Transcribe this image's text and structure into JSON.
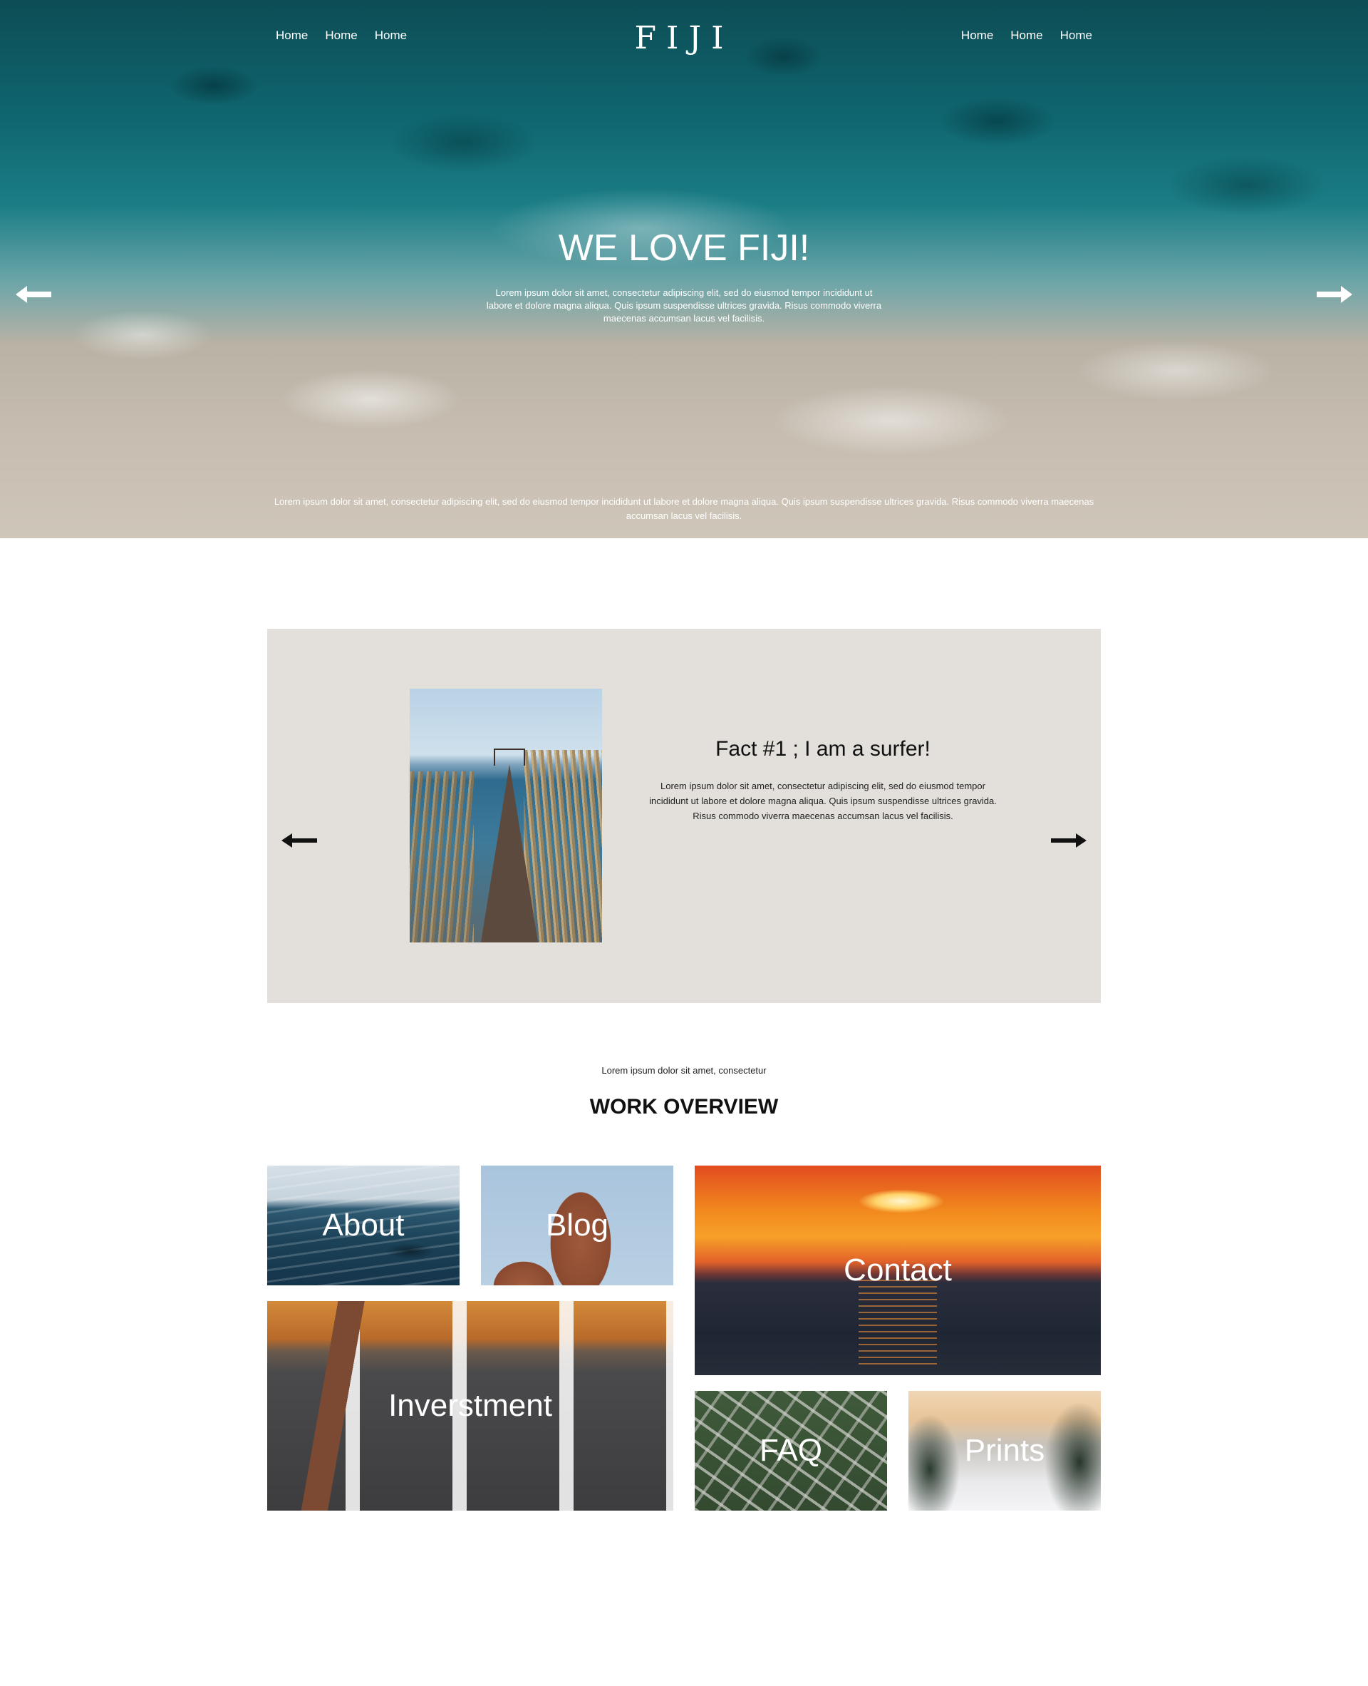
{
  "colors": {
    "fact_background": "#e3e0dc",
    "hero_text": "#ffffff",
    "heading_text": "#111111"
  },
  "header": {
    "logo": "FIJI",
    "nav_left": [
      "Home",
      "Home",
      "Home"
    ],
    "nav_right": [
      "Home",
      "Home",
      "Home"
    ]
  },
  "hero": {
    "title": "WE LOVE FIJI!",
    "subtitle": "Lorem ipsum dolor sit amet, consectetur adipiscing elit, sed do eiusmod tempor incididunt ut labore et dolore magna aliqua. Quis ipsum suspendisse ultrices gravida. Risus commodo viverra maecenas accumsan lacus vel facilisis.",
    "footer_text": "Lorem ipsum dolor sit amet, consectetur adipiscing elit, sed do eiusmod tempor incididunt ut labore et dolore magna aliqua. Quis ipsum suspendisse ultrices gravida. Risus commodo viverra maecenas accumsan lacus vel facilisis.",
    "prev_icon": "arrow-left-icon",
    "next_icon": "arrow-right-icon"
  },
  "fact": {
    "title": "Fact #1 ; I am a surfer!",
    "text": "Lorem ipsum dolor sit amet, consectetur adipiscing elit, sed do eiusmod tempor incididunt ut labore et dolore magna aliqua. Quis ipsum suspendisse ultrices gravida. Risus commodo viverra maecenas accumsan lacus vel facilisis.",
    "prev_icon": "arrow-left-icon",
    "next_icon": "arrow-right-icon"
  },
  "overview": {
    "kicker": "Lorem ipsum dolor sit amet, consectetur",
    "title": "WORK OVERVIEW",
    "tiles": {
      "about": "About",
      "blog": "Blog",
      "contact": "Contact",
      "investment": "Inverstment",
      "faq": "FAQ",
      "prints": "Prints"
    }
  }
}
